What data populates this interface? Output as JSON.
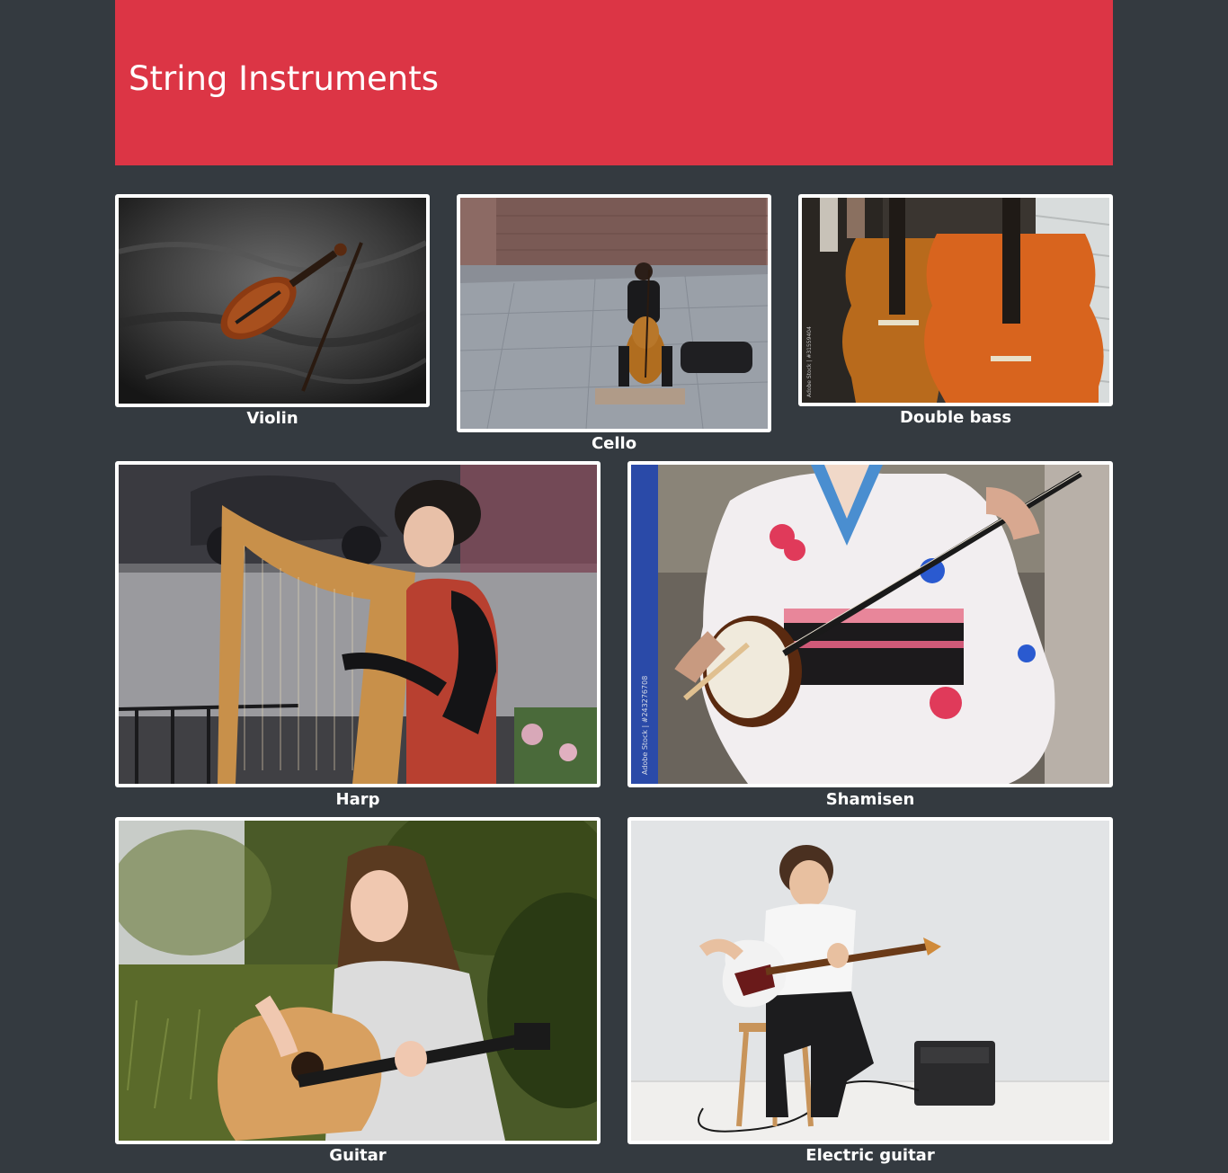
{
  "header": {
    "title": "String Instruments",
    "background": "#dc3545"
  },
  "page": {
    "background": "#343a40"
  },
  "gallery": {
    "items": [
      {
        "label": "Violin",
        "image": "violin-photo"
      },
      {
        "label": "Cello",
        "image": "cello-photo"
      },
      {
        "label": "Double bass",
        "image": "double-bass-photo",
        "watermark": "Adobe Stock | #31559404"
      },
      {
        "label": "Harp",
        "image": "harp-photo"
      },
      {
        "label": "Shamisen",
        "image": "shamisen-photo",
        "watermark": "Adobe Stock | #243276708"
      },
      {
        "label": "Guitar",
        "image": "guitar-photo"
      },
      {
        "label": "Electric guitar",
        "image": "electric-guitar-photo"
      }
    ]
  }
}
